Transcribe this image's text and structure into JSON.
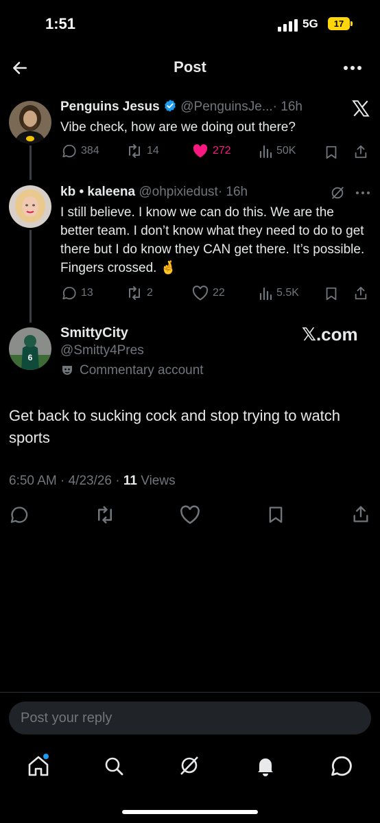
{
  "status_bar": {
    "time": "1:51",
    "network": "5G",
    "battery": "17"
  },
  "header": {
    "title": "Post"
  },
  "thread": [
    {
      "name": "Penguins Jesus",
      "handle": "@PenguinsJe...",
      "time": "· 16h",
      "text": "Vibe check, how are we doing out there?",
      "replies": "384",
      "reposts": "14",
      "likes": "272",
      "views": "50K"
    },
    {
      "name": "kb • kaleena",
      "handle": "@ohpixiedust",
      "time": "· 16h",
      "text": "I still believe. I know we can do this. We are the better team. I don’t know what they need to do to get there but I do know they CAN get there. It’s possible. Fingers crossed. 🤞",
      "replies": "13",
      "reposts": "2",
      "likes": "22",
      "views": "5.5K"
    }
  ],
  "watermark": "𝕏.com",
  "main_post": {
    "name": "SmittyCity",
    "handle": "@Smitty4Pres",
    "label": "Commentary account",
    "text": "Get back to sucking cock and stop trying to watch sports",
    "timestamp": "6:50 AM · 4/23/26 · ",
    "views_count": "11",
    "views_label": " Views"
  },
  "reply_box": {
    "placeholder": "Post your reply"
  },
  "colors": {
    "like_active": "#f91880",
    "verified": "#1d9bf0",
    "text": "#e7e9ea",
    "muted": "#71767b"
  },
  "tab_bar": [
    "home-icon",
    "search-icon",
    "grok-icon",
    "notifications-icon",
    "messages-icon"
  ]
}
